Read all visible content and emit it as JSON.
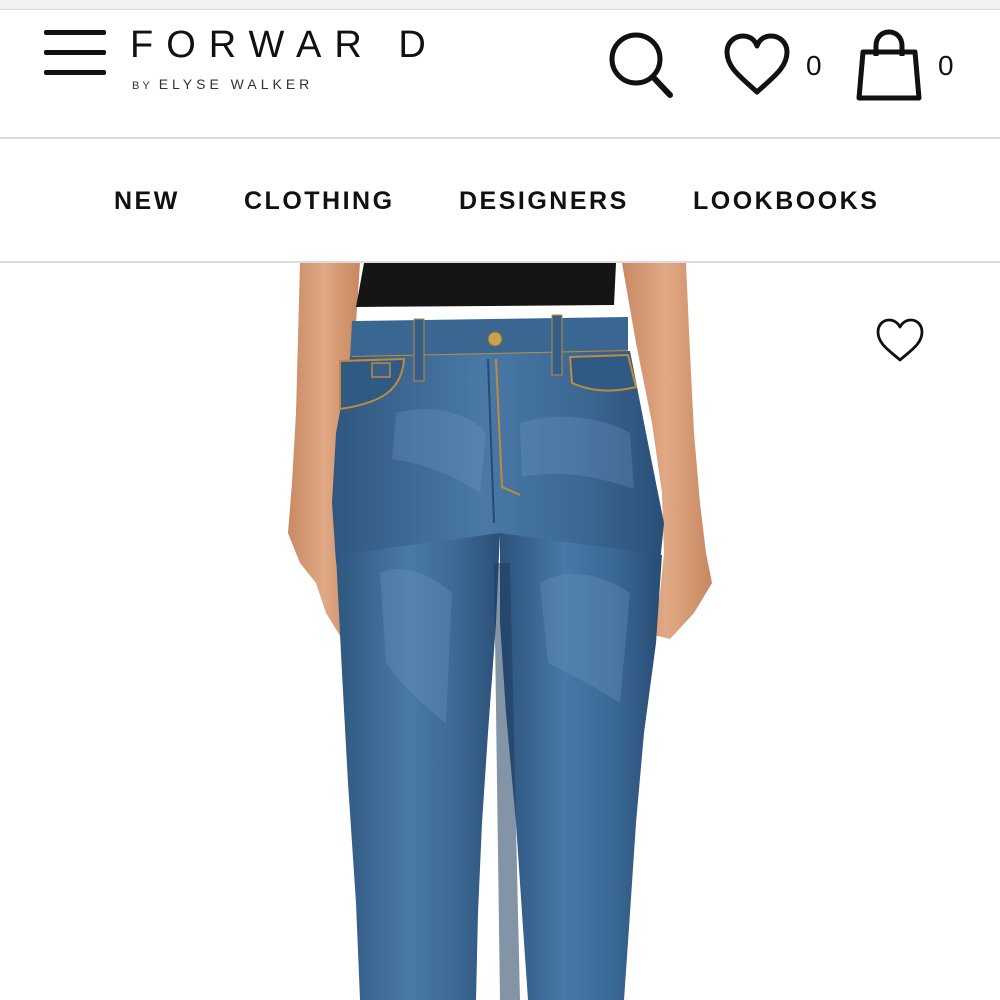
{
  "header": {
    "logo": {
      "main": "FORWAR D",
      "by": "BY",
      "sub": "ELYSE WALKER"
    },
    "icons": {
      "menu": "hamburger-menu-icon",
      "search": "search-icon",
      "wishlist": "heart-icon",
      "bag": "shopping-bag-icon"
    },
    "wishlist_count": "0",
    "bag_count": "0"
  },
  "nav": {
    "items": [
      {
        "label": "NEW"
      },
      {
        "label": "CLOTHING"
      },
      {
        "label": "DESIGNERS"
      },
      {
        "label": "LOOKBOOKS"
      }
    ]
  },
  "product": {
    "image": "model wearing blue flared jeans with black top",
    "favorite_icon": "heart-outline-icon"
  },
  "colors": {
    "text": "#111111",
    "divider": "#dcdcdc",
    "denim": "#3e6a96",
    "skin": "#d9a07a"
  }
}
